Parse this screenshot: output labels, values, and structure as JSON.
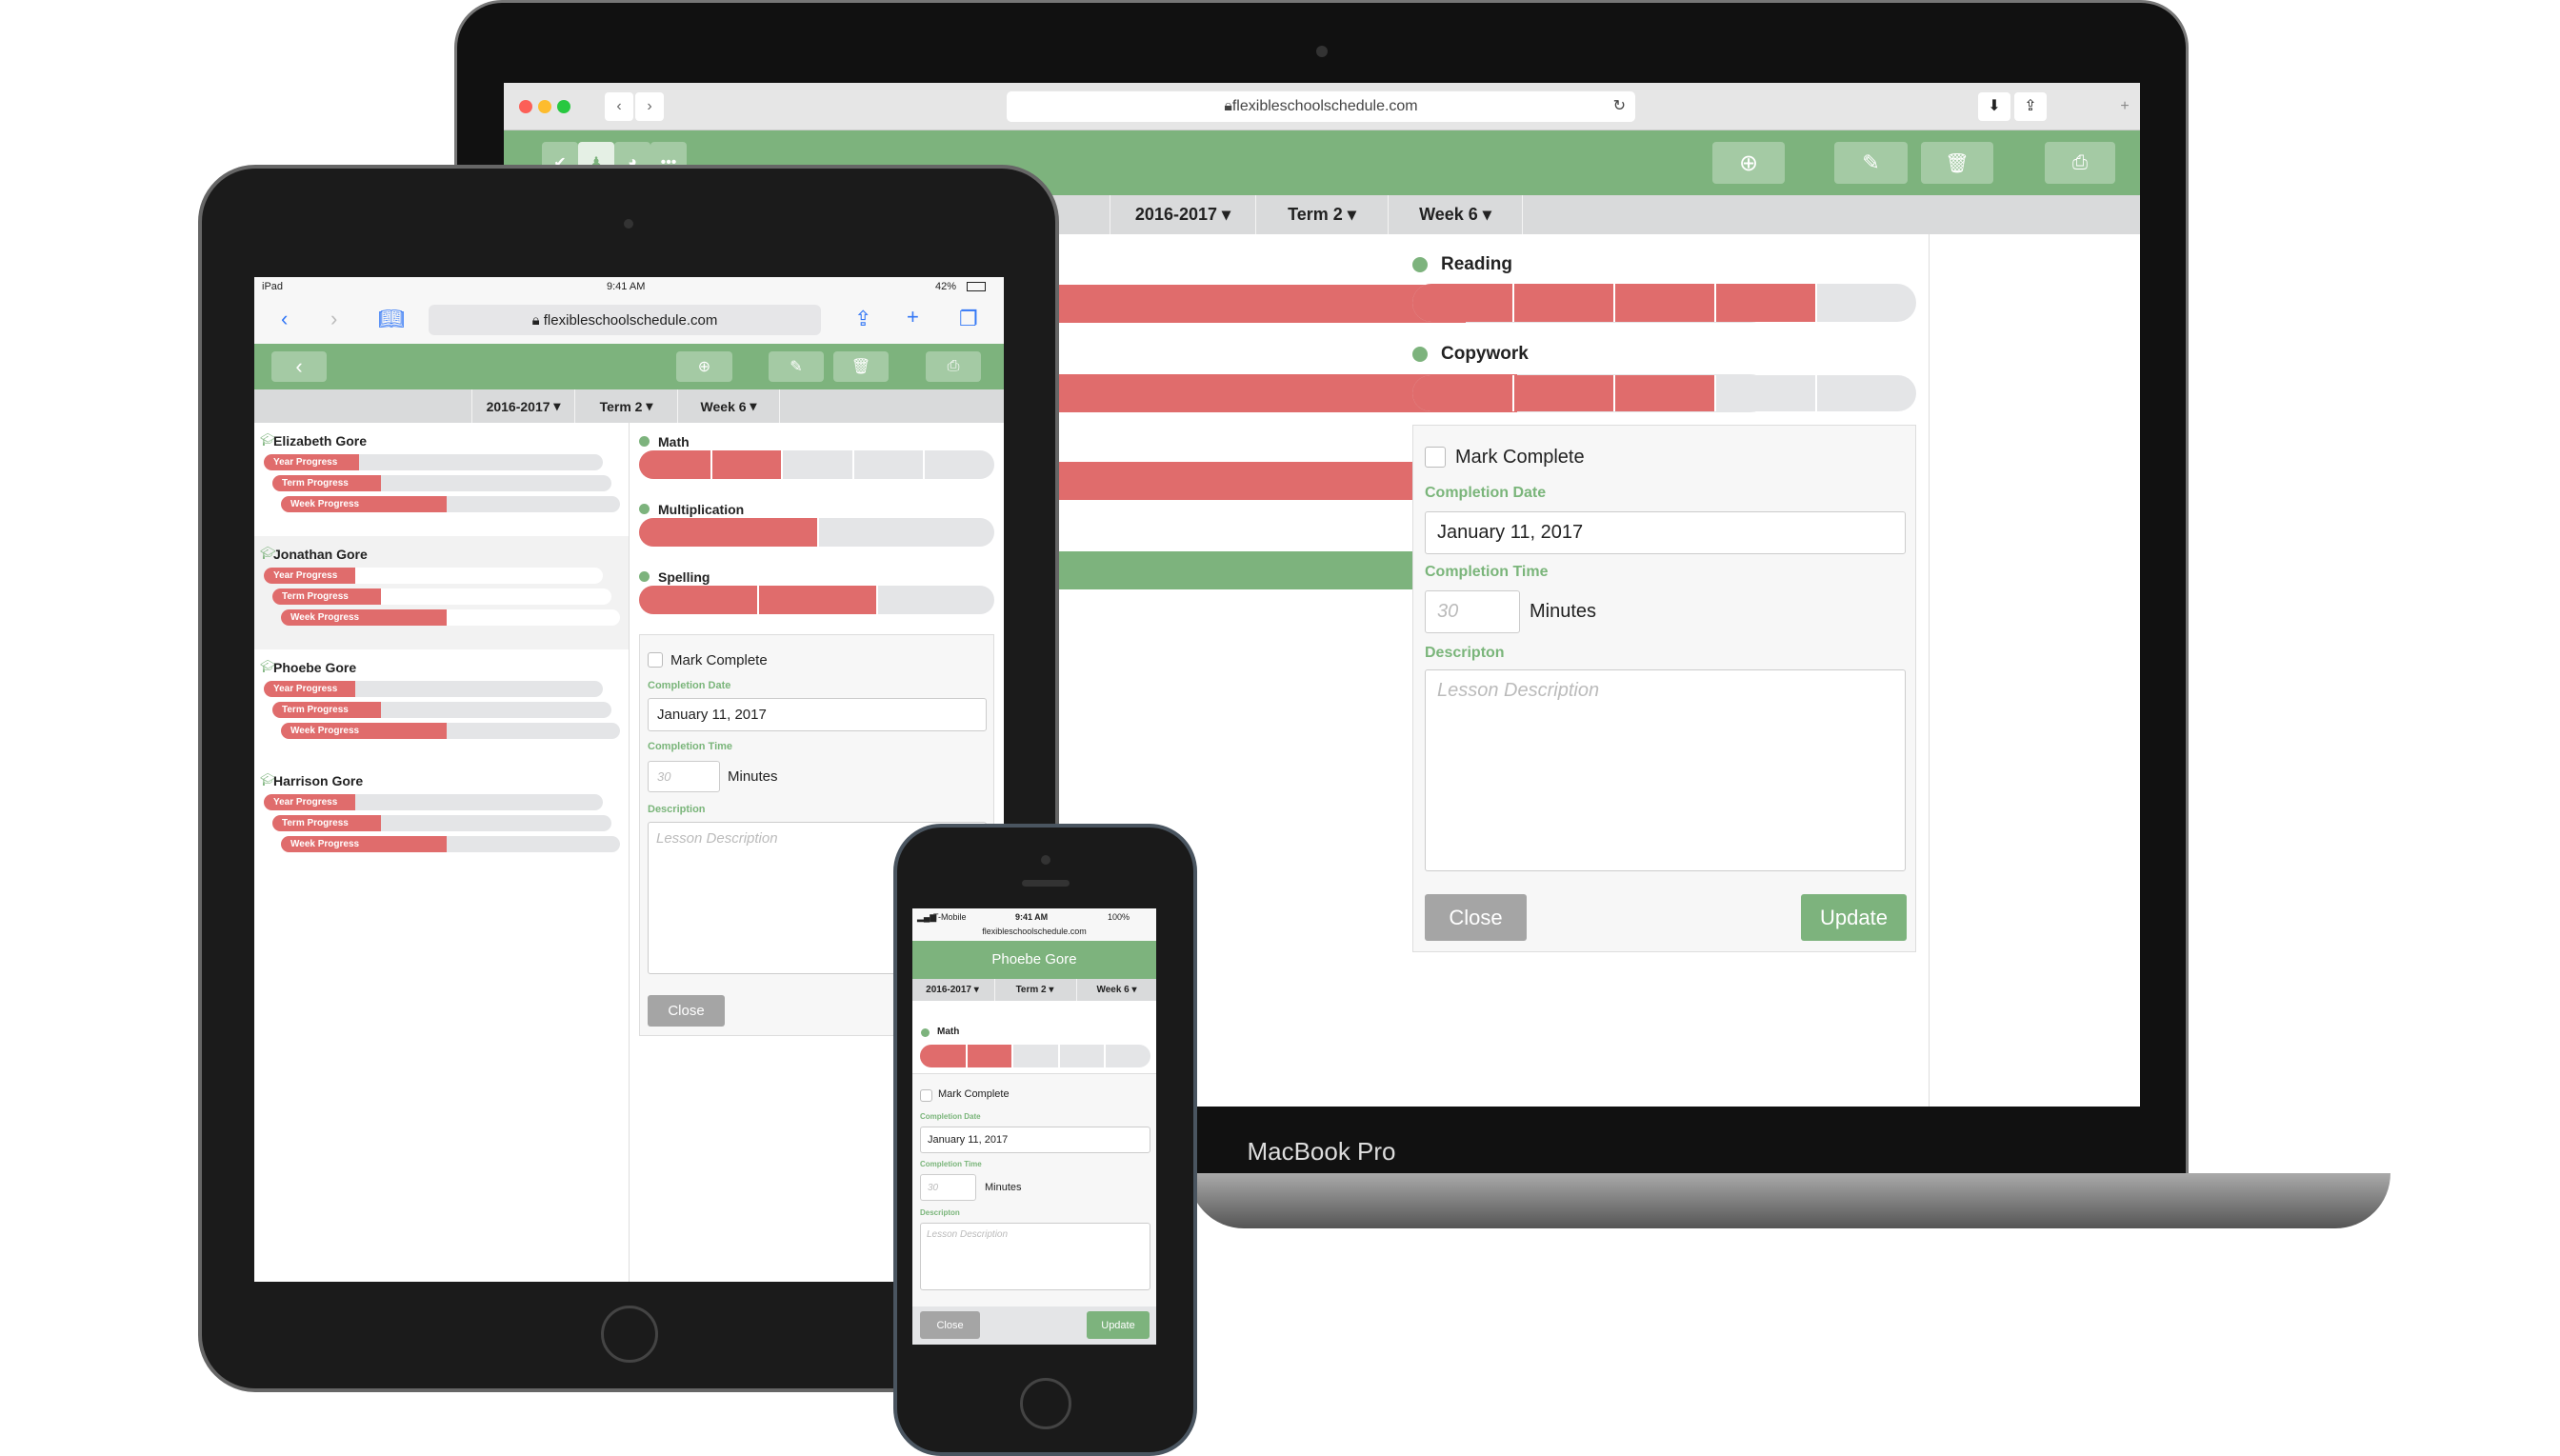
{
  "colors": {
    "accent_green": "#7db37d",
    "progress_red": "#e06c6c",
    "track_gray": "#e4e5e7"
  },
  "laptop": {
    "device_label": "MacBook Pro",
    "url": "flexibleschoolschedule.com",
    "toolbar": {
      "left_icons": [
        "check-icon",
        "student-icon",
        "pie-chart-icon",
        "more-icon"
      ],
      "right_icons": [
        "plus-circle-icon",
        "pencil-icon",
        "trash-icon",
        "print-icon"
      ]
    },
    "filters": {
      "year": "2016-2017",
      "term": "Term 2",
      "week": "Week 6"
    },
    "subjects": [
      {
        "name": "Reading",
        "progress": 0.8
      },
      {
        "name": "Copywork",
        "progress": 0.6
      }
    ],
    "form": {
      "mark_complete": "Mark Complete",
      "date_label": "Completion Date",
      "date_value": "January 11, 2017",
      "time_label": "Completion Time",
      "time_placeholder": "30",
      "time_unit": "Minutes",
      "desc_label": "Descripton",
      "desc_placeholder": "Lesson Description",
      "close": "Close",
      "update": "Update"
    }
  },
  "ipad": {
    "status": {
      "device": "iPad",
      "time": "9:41 AM",
      "battery": "42%"
    },
    "url": "flexibleschoolschedule.com",
    "filters": {
      "year": "2016-2017",
      "term": "Term 2",
      "week": "Week 6"
    },
    "students": [
      {
        "name": "Elizabeth Gore",
        "year": "Year Progress",
        "term": "Term Progress",
        "week": "Week Progress",
        "year_p": 0.28,
        "term_p": 0.32,
        "week_p": 0.49
      },
      {
        "name": "Jonathan Gore",
        "year": "Year Progress",
        "term": "Term Progress",
        "week": "Week Progress",
        "year_p": 0.27,
        "term_p": 0.32,
        "week_p": 0.49
      },
      {
        "name": "Phoebe Gore",
        "year": "Year Progress",
        "term": "Term Progress",
        "week": "Week Progress",
        "year_p": 0.27,
        "term_p": 0.32,
        "week_p": 0.49
      },
      {
        "name": "Harrison Gore",
        "year": "Year Progress",
        "term": "Term Progress",
        "week": "Week Progress",
        "year_p": 0.27,
        "term_p": 0.32,
        "week_p": 0.49
      }
    ],
    "subjects": [
      {
        "name": "Math",
        "progress": 0.4,
        "segments": 5
      },
      {
        "name": "Multiplication",
        "progress": 0.5,
        "segments": 2
      },
      {
        "name": "Spelling",
        "progress": 0.667,
        "segments": 3
      }
    ],
    "form": {
      "mark_complete": "Mark Complete",
      "date_label": "Completion Date",
      "date_value": "January 11, 2017",
      "time_label": "Completion Time",
      "time_placeholder": "30",
      "time_unit": "Minutes",
      "desc_label": "Description",
      "desc_placeholder": "Lesson Description",
      "close": "Close"
    }
  },
  "iphone": {
    "status": {
      "carrier": "T-Mobile",
      "time": "9:41 AM",
      "battery": "100%"
    },
    "url": "flexibleschoolschedule.com",
    "title": "Phoebe Gore",
    "filters": {
      "year": "2016-2017",
      "term": "Term 2",
      "week": "Week 6"
    },
    "subject": {
      "name": "Math",
      "progress": 0.4
    },
    "form": {
      "mark_complete": "Mark Complete",
      "date_label": "Completion Date",
      "date_value": "January 11, 2017",
      "time_label": "Completion Time",
      "time_placeholder": "30",
      "time_unit": "Minutes",
      "desc_label": "Descripton",
      "desc_placeholder": "Lesson Description",
      "close": "Close",
      "update": "Update"
    }
  }
}
